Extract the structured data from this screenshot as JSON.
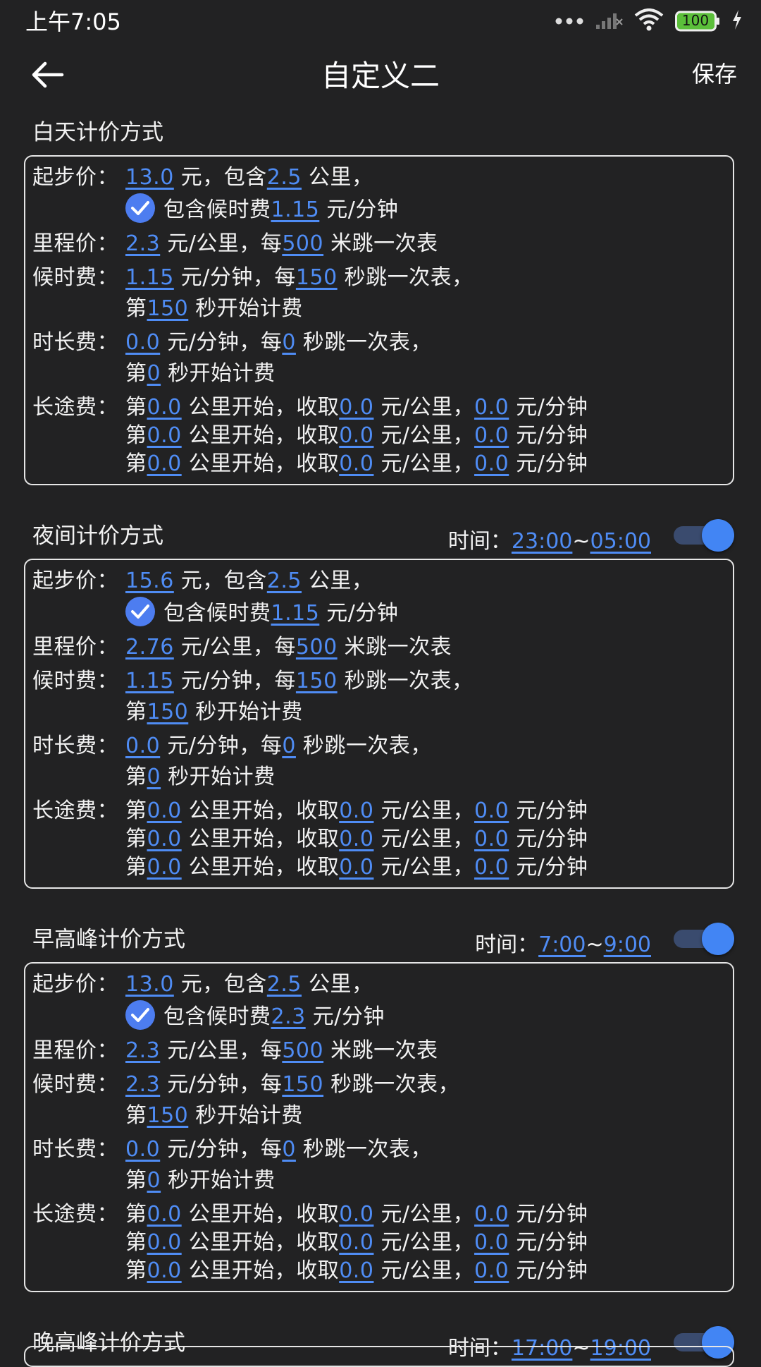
{
  "status_bar": {
    "time": "上午7:05",
    "battery": "100"
  },
  "header": {
    "title": "自定义二",
    "save_label": "保存"
  },
  "sections": [
    {
      "title": "白天计价方式",
      "start_label": "起步价：",
      "start_price": "13.0",
      "start_unit_text": "元，包含",
      "start_km": "2.5",
      "start_km_unit": "公里，",
      "wait_include_prefix": "包含候时费",
      "wait_include_value": "1.15",
      "wait_include_unit": "元/分钟",
      "mileage_label": "里程价：",
      "mileage_price": "2.3",
      "mileage_mid": "元/公里，每",
      "mileage_meters": "500",
      "mileage_tail": "米跳一次表",
      "wait_label": "候时费：",
      "wait_price": "1.15",
      "wait_mid": "元/分钟，每",
      "wait_seconds": "150",
      "wait_tail": "秒跳一次表，",
      "wait_start_prefix": "第",
      "wait_start": "150",
      "wait_start_tail": "秒开始计费",
      "duration_label": "时长费：",
      "duration_price": "0.0",
      "duration_mid": "元/分钟，每",
      "duration_seconds": "0",
      "duration_tail": "秒跳一次表，",
      "duration_start_prefix": "第",
      "duration_start": "0",
      "duration_start_tail": "秒开始计费",
      "long_label": "长途费：",
      "long_rows": [
        {
          "p": "第",
          "km": "0.0",
          "m1": "公里开始，收取",
          "per_km": "0.0",
          "m2": "元/公里，",
          "per_min": "0.0",
          "m3": "元/分钟"
        },
        {
          "p": "第",
          "km": "0.0",
          "m1": "公里开始，收取",
          "per_km": "0.0",
          "m2": "元/公里，",
          "per_min": "0.0",
          "m3": "元/分钟"
        },
        {
          "p": "第",
          "km": "0.0",
          "m1": "公里开始，收取",
          "per_km": "0.0",
          "m2": "元/公里，",
          "per_min": "0.0",
          "m3": "元/分钟"
        }
      ]
    },
    {
      "title": "夜间计价方式",
      "time_label": "时间：",
      "time_start": "23:00",
      "time_sep": "~",
      "time_end": "05:00",
      "enabled": true,
      "start_label": "起步价：",
      "start_price": "15.6",
      "start_unit_text": "元，包含",
      "start_km": "2.5",
      "start_km_unit": "公里，",
      "wait_include_prefix": "包含候时费",
      "wait_include_value": "1.15",
      "wait_include_unit": "元/分钟",
      "mileage_label": "里程价：",
      "mileage_price": "2.76",
      "mileage_mid": "元/公里，每",
      "mileage_meters": "500",
      "mileage_tail": "米跳一次表",
      "wait_label": "候时费：",
      "wait_price": "1.15",
      "wait_mid": "元/分钟，每",
      "wait_seconds": "150",
      "wait_tail": "秒跳一次表，",
      "wait_start_prefix": "第",
      "wait_start": "150",
      "wait_start_tail": "秒开始计费",
      "duration_label": "时长费：",
      "duration_price": "0.0",
      "duration_mid": "元/分钟，每",
      "duration_seconds": "0",
      "duration_tail": "秒跳一次表，",
      "duration_start_prefix": "第",
      "duration_start": "0",
      "duration_start_tail": "秒开始计费",
      "long_label": "长途费：",
      "long_rows": [
        {
          "p": "第",
          "km": "0.0",
          "m1": "公里开始，收取",
          "per_km": "0.0",
          "m2": "元/公里，",
          "per_min": "0.0",
          "m3": "元/分钟"
        },
        {
          "p": "第",
          "km": "0.0",
          "m1": "公里开始，收取",
          "per_km": "0.0",
          "m2": "元/公里，",
          "per_min": "0.0",
          "m3": "元/分钟"
        },
        {
          "p": "第",
          "km": "0.0",
          "m1": "公里开始，收取",
          "per_km": "0.0",
          "m2": "元/公里，",
          "per_min": "0.0",
          "m3": "元/分钟"
        }
      ]
    },
    {
      "title": "早高峰计价方式",
      "time_label": "时间：",
      "time_start": "7:00",
      "time_sep": "~",
      "time_end": "9:00",
      "enabled": true,
      "start_label": "起步价：",
      "start_price": "13.0",
      "start_unit_text": "元，包含",
      "start_km": "2.5",
      "start_km_unit": "公里，",
      "wait_include_prefix": "包含候时费",
      "wait_include_value": "2.3",
      "wait_include_unit": "元/分钟",
      "mileage_label": "里程价：",
      "mileage_price": "2.3",
      "mileage_mid": "元/公里，每",
      "mileage_meters": "500",
      "mileage_tail": "米跳一次表",
      "wait_label": "候时费：",
      "wait_price": "2.3",
      "wait_mid": "元/分钟，每",
      "wait_seconds": "150",
      "wait_tail": "秒跳一次表，",
      "wait_start_prefix": "第",
      "wait_start": "150",
      "wait_start_tail": "秒开始计费",
      "duration_label": "时长费：",
      "duration_price": "0.0",
      "duration_mid": "元/分钟，每",
      "duration_seconds": "0",
      "duration_tail": "秒跳一次表，",
      "duration_start_prefix": "第",
      "duration_start": "0",
      "duration_start_tail": "秒开始计费",
      "long_label": "长途费：",
      "long_rows": [
        {
          "p": "第",
          "km": "0.0",
          "m1": "公里开始，收取",
          "per_km": "0.0",
          "m2": "元/公里，",
          "per_min": "0.0",
          "m3": "元/分钟"
        },
        {
          "p": "第",
          "km": "0.0",
          "m1": "公里开始，收取",
          "per_km": "0.0",
          "m2": "元/公里，",
          "per_min": "0.0",
          "m3": "元/分钟"
        },
        {
          "p": "第",
          "km": "0.0",
          "m1": "公里开始，收取",
          "per_km": "0.0",
          "m2": "元/公里，",
          "per_min": "0.0",
          "m3": "元/分钟"
        }
      ]
    },
    {
      "title": "晚高峰计价方式",
      "time_label": "时间：",
      "time_start": "17:00",
      "time_sep": "~",
      "time_end": "19:00",
      "enabled": true
    }
  ]
}
